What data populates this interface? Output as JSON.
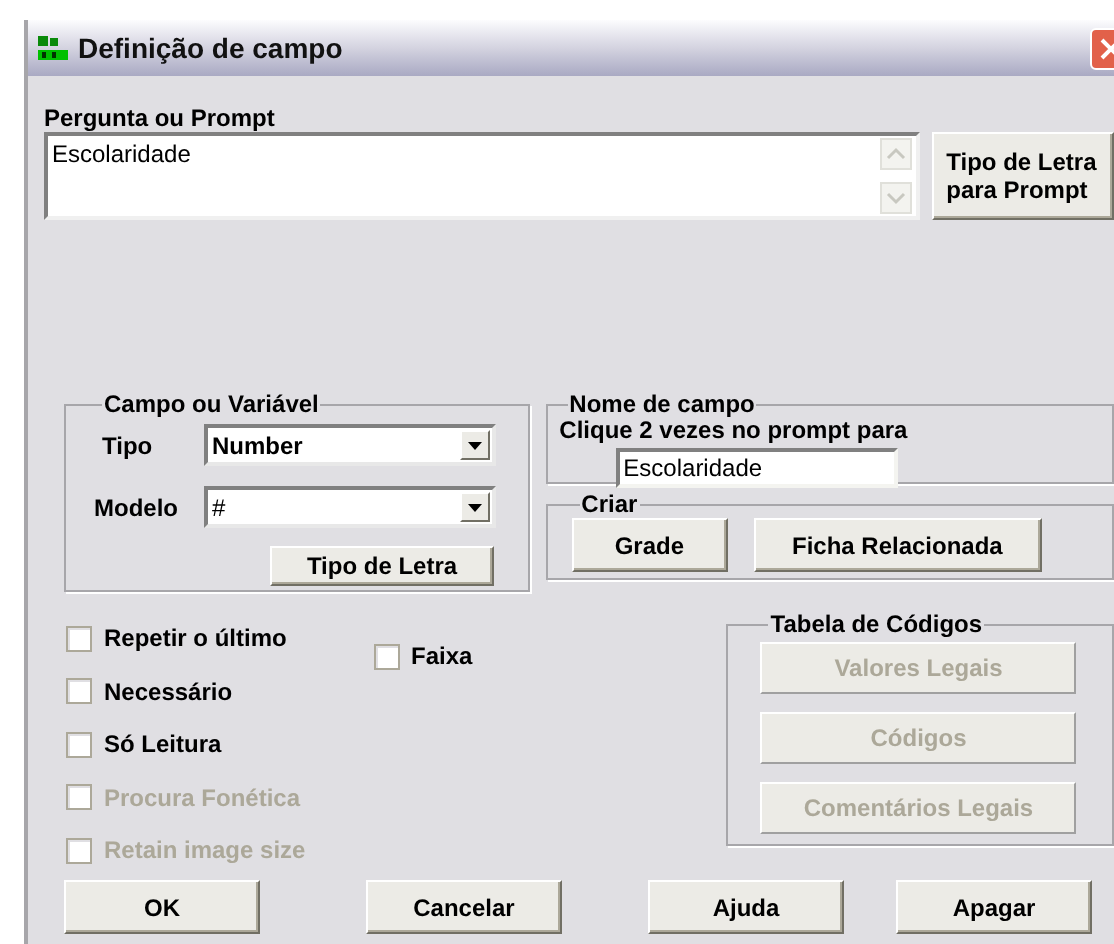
{
  "window": {
    "title": "Definição de campo"
  },
  "prompt": {
    "label": "Pergunta ou Prompt",
    "value": "Escolaridade",
    "font_button": "Tipo de Letra para Prompt"
  },
  "field_group": {
    "title": "Campo ou Variável",
    "fields": [
      {
        "label": "Tipo",
        "value": "Number"
      },
      {
        "label": "Modelo",
        "value": "#"
      }
    ],
    "font_button": "Tipo de Letra"
  },
  "field_name": {
    "title": "Nome de campo",
    "hint": "Clique 2 vezes no prompt para",
    "value": "Escolaridade"
  },
  "create": {
    "title": "Criar",
    "buttons": [
      "Grade",
      "Ficha Relacionada"
    ]
  },
  "options": [
    {
      "label": "Repetir o último",
      "checked": false,
      "disabled": false
    },
    {
      "label": "Necessário",
      "checked": false,
      "disabled": false
    },
    {
      "label": "Só Leitura",
      "checked": false,
      "disabled": false
    },
    {
      "label": "Procura Fonética",
      "checked": false,
      "disabled": true
    },
    {
      "label": "Retain image size",
      "checked": false,
      "disabled": true
    }
  ],
  "range_option": {
    "label": "Faixa",
    "checked": false
  },
  "code_table": {
    "title": "Tabela de Códigos",
    "buttons": [
      {
        "label": "Valores Legais",
        "disabled": true
      },
      {
        "label": "Códigos",
        "disabled": true
      },
      {
        "label": "Comentários Legais",
        "disabled": true
      }
    ]
  },
  "buttons": [
    "OK",
    "Cancelar",
    "Ajuda",
    "Apagar"
  ]
}
